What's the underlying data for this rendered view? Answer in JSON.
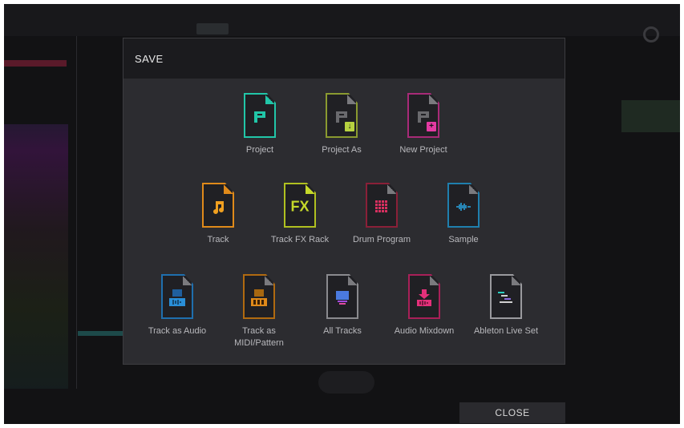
{
  "dialog": {
    "title": "SAVE",
    "rows": [
      [
        {
          "label": "Project",
          "color": "#21c6a8",
          "icon": "project-p-icon"
        },
        {
          "label": "Project As",
          "color": "#a6b43b",
          "icon": "project-as-icon",
          "badge": "↓",
          "badge_color": "#b7d240"
        },
        {
          "label": "New Project",
          "color": "#c12a88",
          "icon": "new-project-icon",
          "badge": "+",
          "badge_color": "#e43aa3"
        }
      ],
      [
        {
          "label": "Track",
          "color": "#f0a020",
          "icon": "music-note-icon"
        },
        {
          "label": "Track FX Rack",
          "color": "#c5d82a",
          "icon": "fx-icon",
          "glyph_text": "FX"
        },
        {
          "label": "Drum Program",
          "color": "#d83060",
          "icon": "drum-pad-grid-icon"
        },
        {
          "label": "Sample",
          "color": "#2a9fd8",
          "icon": "waveform-icon"
        }
      ],
      [
        {
          "label": "Track as Audio",
          "color": "#2a8fd8",
          "icon": "track-audio-icon"
        },
        {
          "label": "Track as MIDI/Pattern",
          "color": "#e08a1a",
          "icon": "track-midi-icon"
        },
        {
          "label": "All Tracks",
          "color": "#5a6adf",
          "icon": "all-tracks-icon"
        },
        {
          "label": "Audio Mixdown",
          "color": "#e4307a",
          "icon": "audio-mixdown-icon"
        },
        {
          "label": "Ableton Live Set",
          "color": "#d0d0d0",
          "icon": "ableton-set-icon"
        }
      ]
    ]
  },
  "footer": {
    "close_label": "CLOSE"
  }
}
